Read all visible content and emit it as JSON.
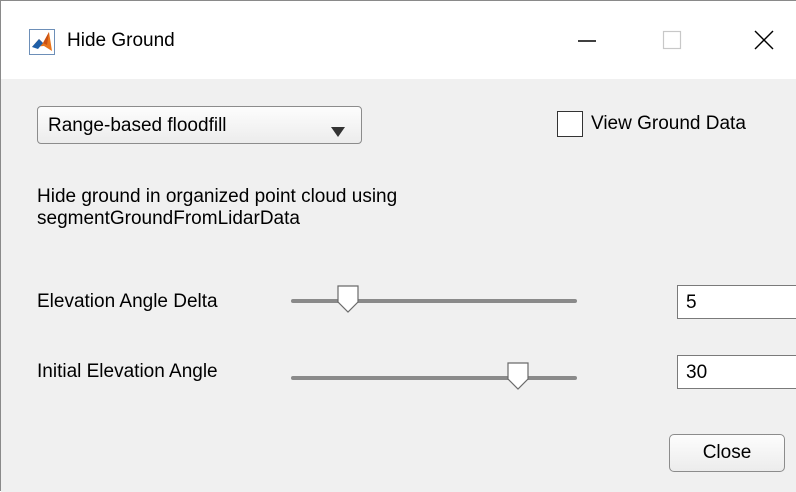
{
  "window": {
    "title": "Hide Ground",
    "controls": {
      "minimize_icon": "minimize-icon",
      "maximize_icon": "maximize-icon",
      "close_icon": "close-icon"
    }
  },
  "method_dropdown": {
    "selected": "Range-based floodfill",
    "arrow_icon": "triangle-down-icon"
  },
  "view_ground_checkbox": {
    "label": "View Ground Data",
    "checked": false
  },
  "description": "Hide ground in organized point cloud using segmentGroundFromLidarData",
  "parameters": [
    {
      "label": "Elevation Angle Delta",
      "value": "5",
      "slider_fraction": 0.2
    },
    {
      "label": "Initial Elevation Angle",
      "value": "30",
      "slider_fraction": 0.795
    }
  ],
  "close_button": {
    "label": "Close"
  },
  "colors": {
    "background": "#f0f0f0",
    "titlebar": "#ffffff",
    "app_icon_orange": "#e8741c",
    "app_icon_blue": "#1f5fa8",
    "slider_track": "#8a8a8a",
    "slider_thumb": "#ffffff"
  }
}
